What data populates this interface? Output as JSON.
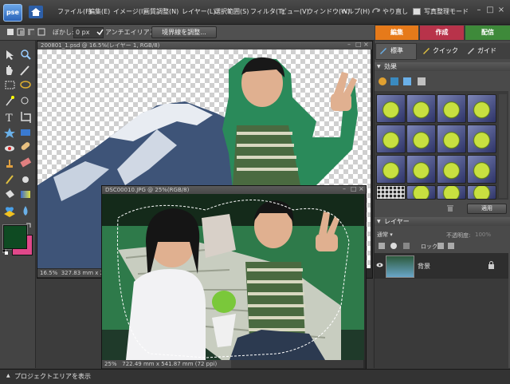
{
  "app": {
    "logo_text": "pse",
    "menus": [
      "ファイル(F)",
      "編集(E)",
      "イメージ(I)",
      "画質調整(N)",
      "レイヤー(L)",
      "選択範囲(S)",
      "フィルタ(T)",
      "ビュー(V)",
      "ウィンドウ(W)",
      "ヘルプ(H)"
    ],
    "undo_label": "やり直し",
    "organizer_label": "写真整理モード"
  },
  "options_bar": {
    "feather_label": "ぼかし:",
    "feather_value": "0 px",
    "antialias_label": "アンチエイリアス",
    "refine_edge_label": "境界線を調整..."
  },
  "mode_tabs": [
    {
      "label": "編集",
      "color": "#e67a1a"
    },
    {
      "label": "作成",
      "color": "#c23a4a"
    },
    {
      "label": "配信",
      "color": "#3e8a3a"
    }
  ],
  "colors": {
    "foreground": "#0e4a22",
    "background": "#e0488a"
  },
  "documents": [
    {
      "title": "200801_1.psd @ 16.5%(レイヤー 1, RGB/8)",
      "zoom": "16.5%",
      "size": "327.83 mm x 24"
    },
    {
      "title": "DSC00010.JPG @ 25%(RGB/8)",
      "zoom": "25%",
      "size": "722.49 mm x 541.87 mm (72 ppi)"
    }
  ],
  "panel": {
    "tabs": [
      "標準",
      "クイック",
      "ガイド"
    ],
    "effects_label": "効果",
    "apply_label": "適用",
    "layers_label": "レイヤー",
    "blend_mode": "通常",
    "opacity_label": "不透明度:",
    "opacity_value": "100%",
    "lock_label": "ロック",
    "layer_name": "背景"
  },
  "bottom_bar": {
    "label": "プロジェクトエリアを表示"
  }
}
